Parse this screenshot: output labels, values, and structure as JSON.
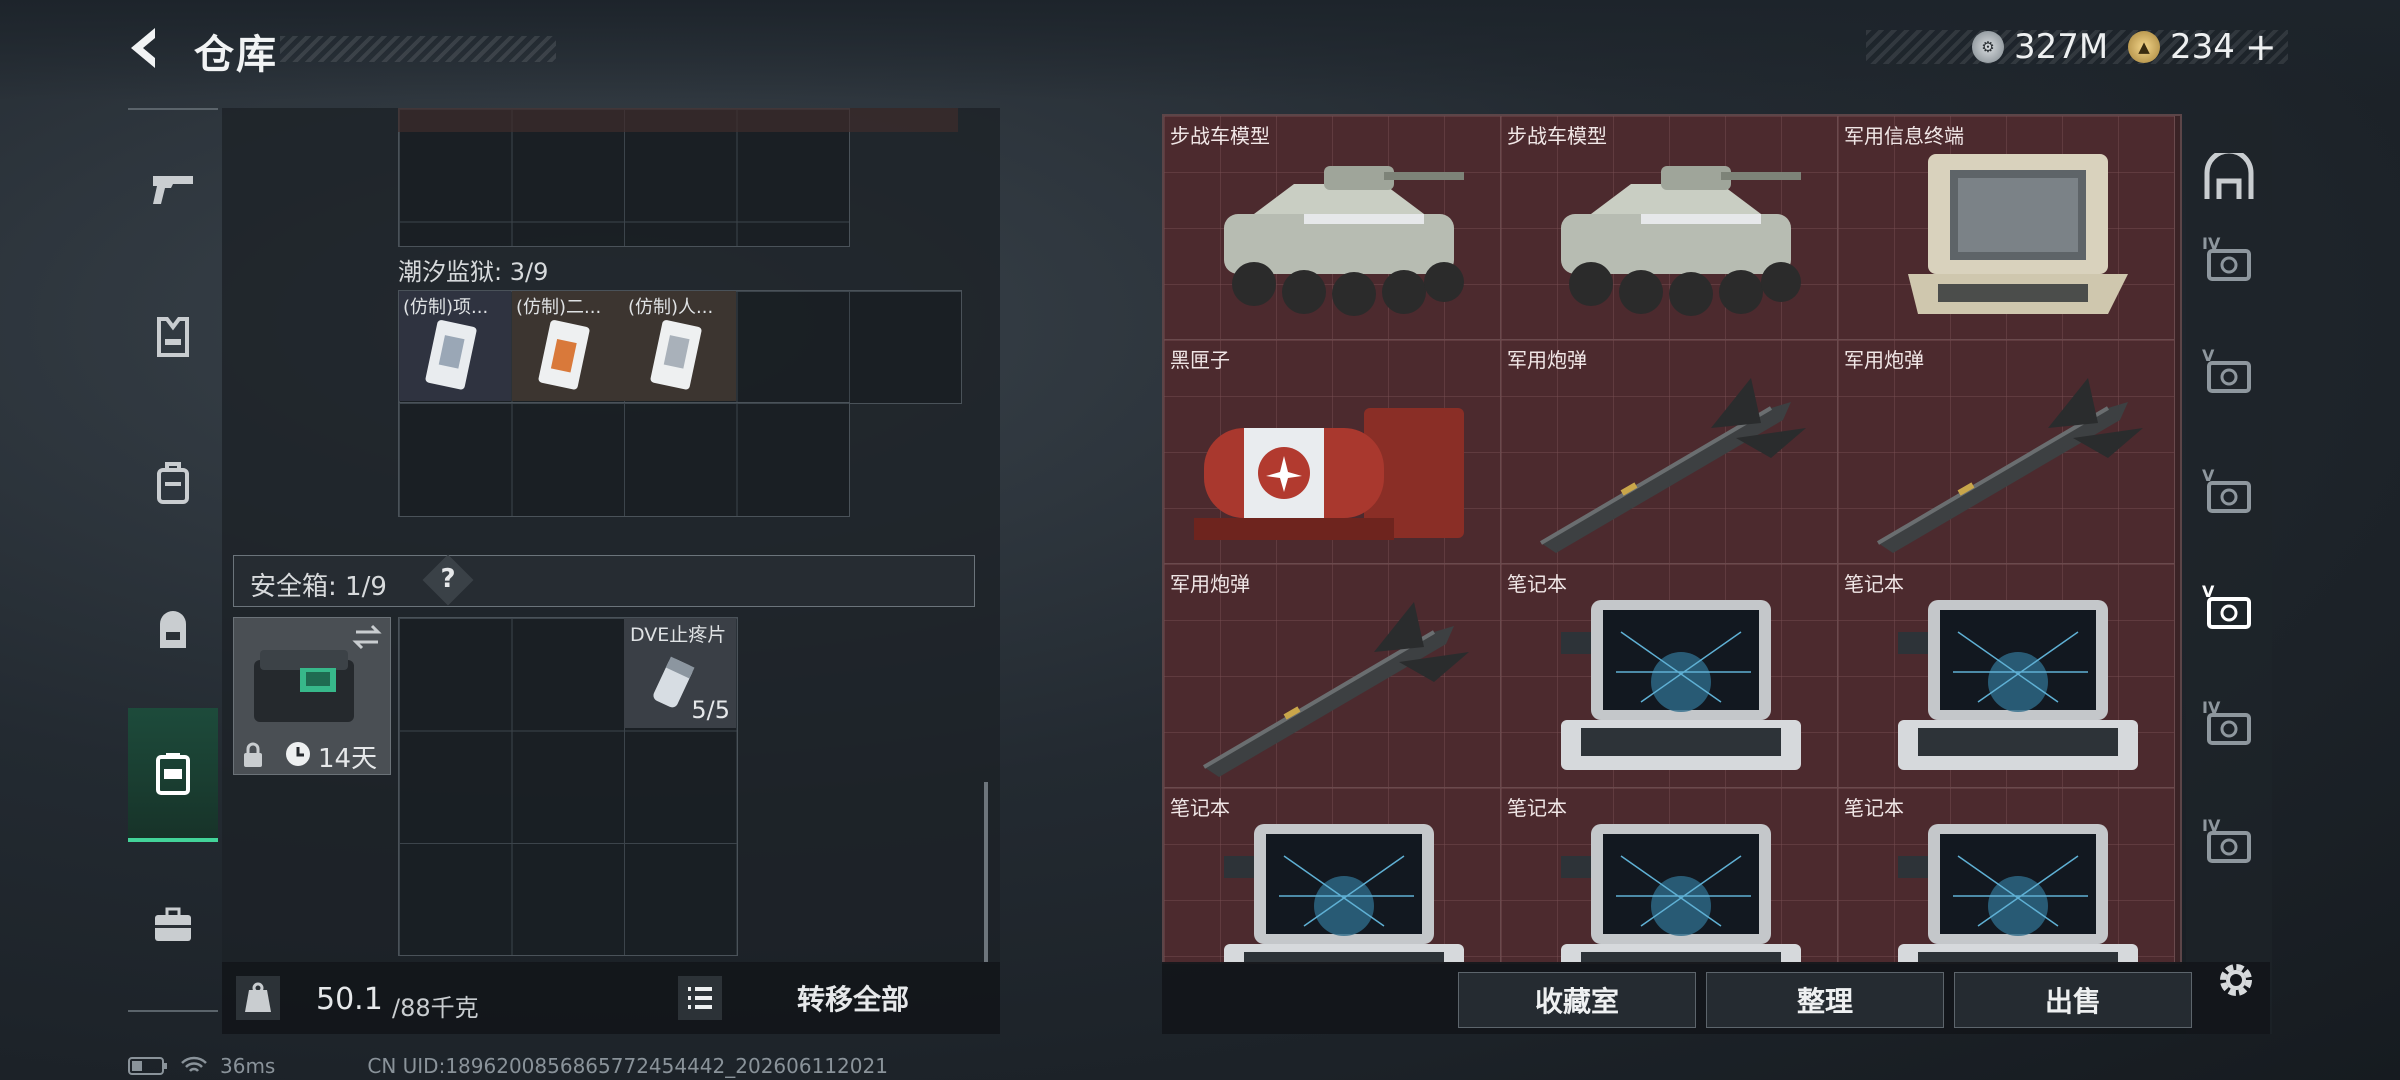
{
  "header": {
    "title": "仓库",
    "currency": [
      {
        "icon": "silver-coin-icon",
        "value": "327M"
      },
      {
        "icon": "gold-coin-icon",
        "value": "234"
      }
    ],
    "add_symbol": "+"
  },
  "sidebar": {
    "items": [
      {
        "icon": "pistol-icon"
      },
      {
        "icon": "vest-icon"
      },
      {
        "icon": "backpack-rig-icon"
      },
      {
        "icon": "backpack-icon"
      },
      {
        "icon": "safe-case-icon",
        "active": true
      },
      {
        "icon": "briefcase-icon"
      }
    ]
  },
  "left": {
    "container_label": "潮汐监狱: 3/9",
    "container_items": [
      {
        "name": "(仿制)项..."
      },
      {
        "name": "(仿制)二..."
      },
      {
        "name": "(仿制)人..."
      }
    ],
    "safe": {
      "label": "安全箱: 1/9",
      "help": "?",
      "case_timer": "14天",
      "item_name": "DVE止疼片",
      "item_count": "5/5"
    },
    "weight": {
      "current": "50.1",
      "max": "/88千克"
    },
    "transfer_all": "转移全部"
  },
  "right": {
    "items": [
      {
        "name": "步战车模型",
        "icon": "ifv-model-icon"
      },
      {
        "name": "步战车模型",
        "icon": "ifv-model-icon"
      },
      {
        "name": "军用信息终端",
        "icon": "military-terminal-icon"
      },
      {
        "name": "黑匣子",
        "icon": "black-box-icon"
      },
      {
        "name": "军用炮弹",
        "icon": "missile-icon"
      },
      {
        "name": "军用炮弹",
        "icon": "missile-icon"
      },
      {
        "name": "军用炮弹",
        "icon": "missile-icon"
      },
      {
        "name": "笔记本",
        "icon": "laptop-icon"
      },
      {
        "name": "笔记本",
        "icon": "laptop-icon"
      },
      {
        "name": "笔记本",
        "icon": "laptop-icon"
      },
      {
        "name": "笔记本",
        "icon": "laptop-icon"
      },
      {
        "name": "笔记本",
        "icon": "laptop-icon"
      }
    ],
    "rail_badges": [
      "IV",
      "V",
      "V",
      "V",
      "IV",
      "IV"
    ],
    "buttons": {
      "collection": "收藏室",
      "organize": "整理",
      "sell": "出售"
    }
  },
  "status": {
    "ping": "36ms",
    "uid": "CN UID:1896200856865772454442_202606112021"
  },
  "colors": {
    "accent_green": "#43d49a",
    "stash_bg": "#4c2a2e"
  }
}
